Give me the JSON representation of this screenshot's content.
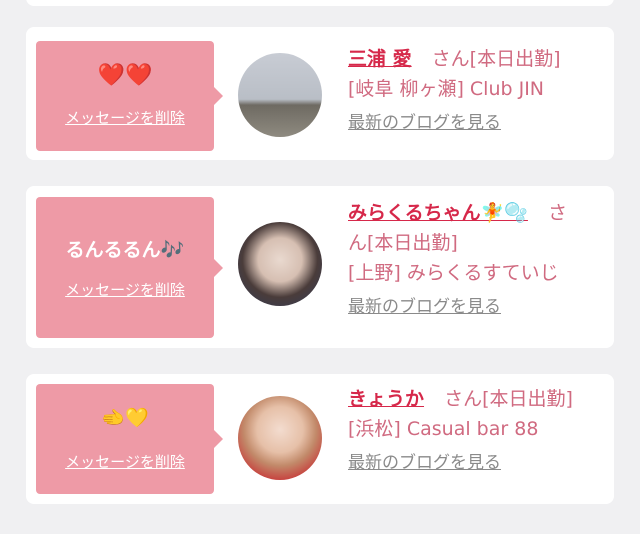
{
  "messages": [
    {
      "bubble_text": "❤️❤️",
      "delete_label": "メッセージを削除",
      "name": "三浦 愛",
      "suffix": "さん[本日出勤]",
      "shop": "[岐阜 柳ヶ瀬] Club JIN",
      "blog_label": "最新のブログを見る"
    },
    {
      "bubble_text": "るんるるん🎶",
      "delete_label": "メッセージを削除",
      "name": "みらくるちゃん🧚🫧",
      "suffix_line1": "さ",
      "suffix_line2": "ん[本日出勤]",
      "shop": "[上野] みらくるすていじ",
      "blog_label": "最新のブログを見る"
    },
    {
      "bubble_text": "🫲💛",
      "delete_label": "メッセージを削除",
      "name": "きょうか",
      "suffix": "さん[本日出勤]",
      "shop": "[浜松] Casual bar 88",
      "blog_label": "最新のブログを見る"
    }
  ],
  "colors": {
    "bubble": "#ee9aa6",
    "name": "#d6284a",
    "text_pink": "#d06a80",
    "link_gray": "#8a8a8a",
    "background": "#f0f0f2"
  }
}
